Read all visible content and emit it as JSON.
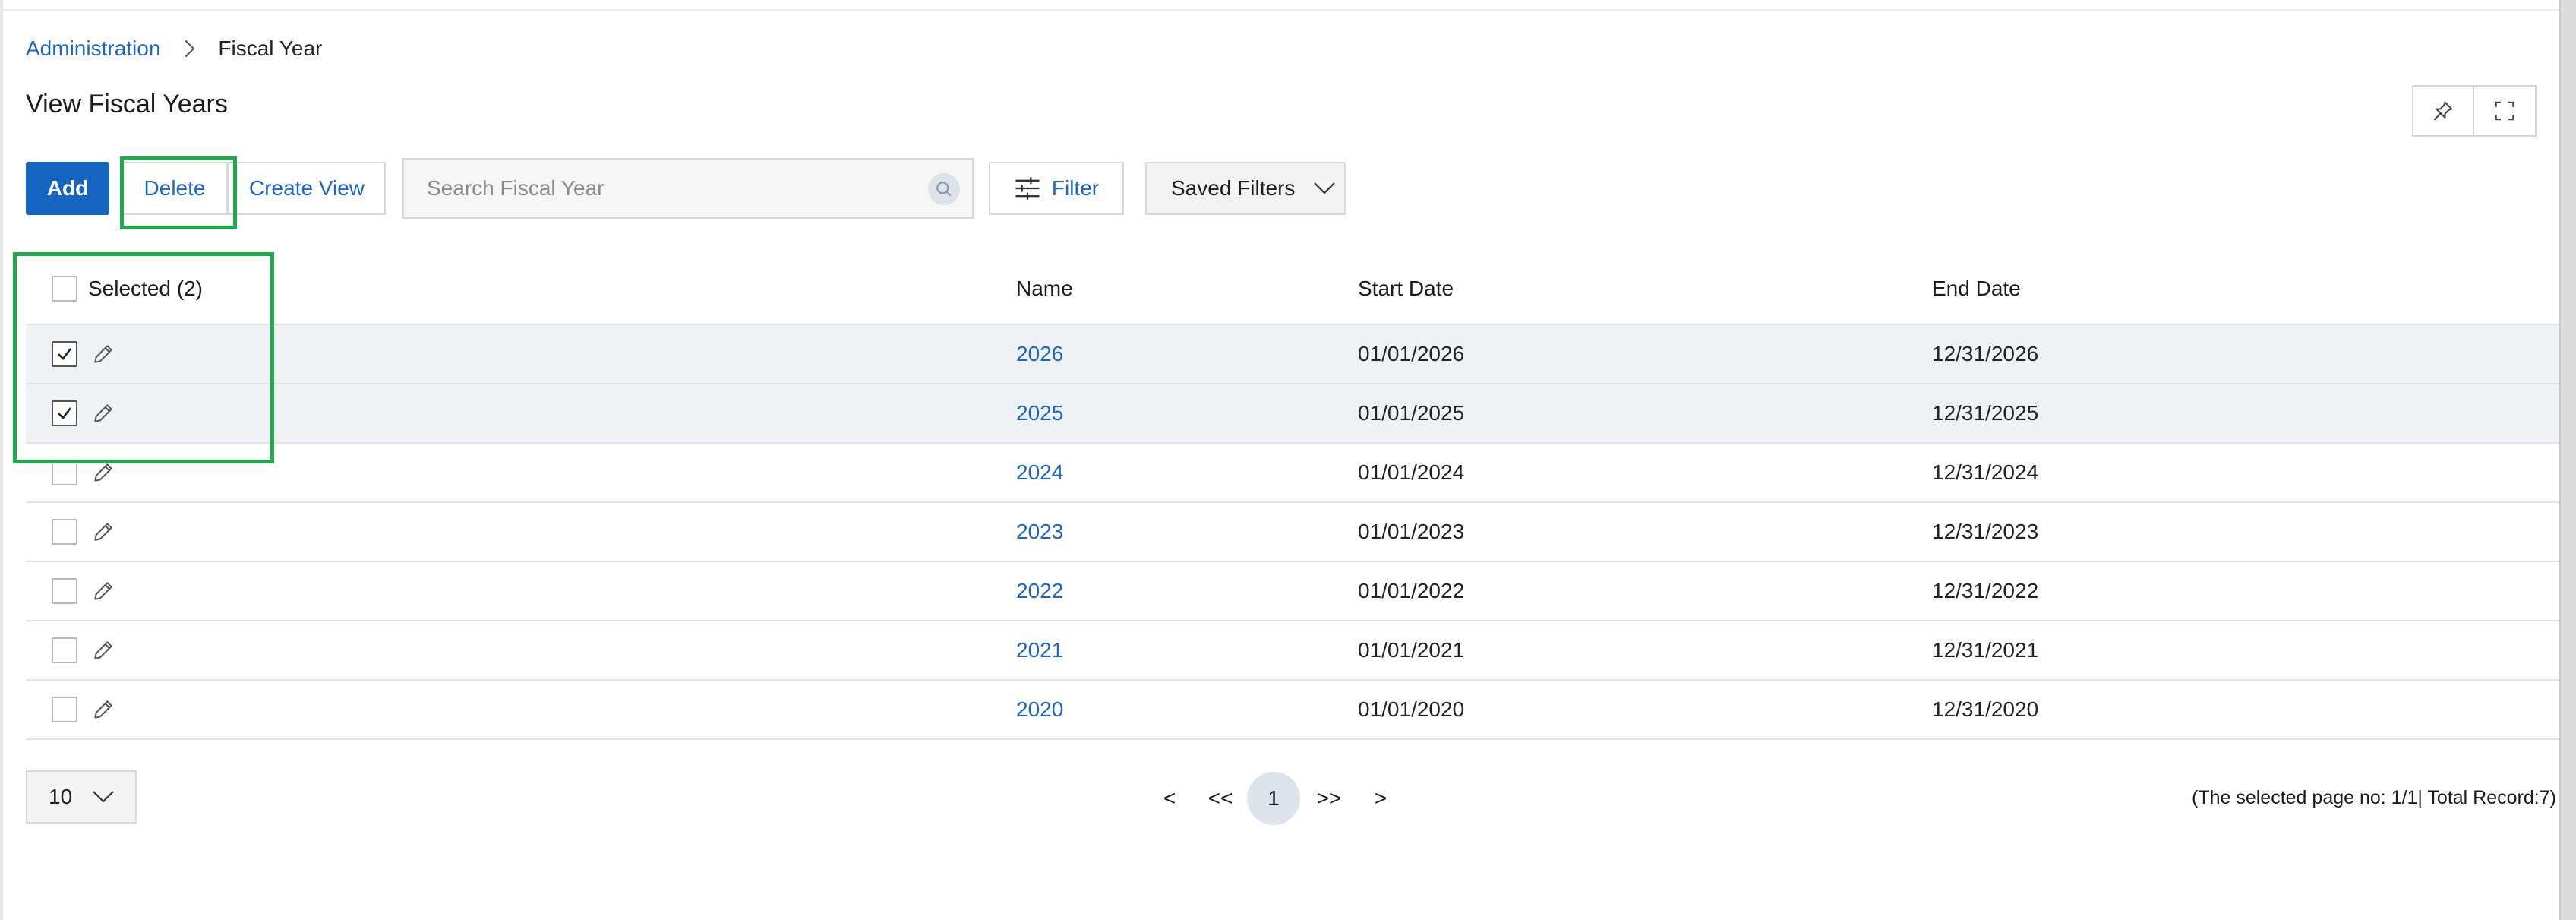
{
  "breadcrumb": {
    "parent": "Administration",
    "current": "Fiscal Year"
  },
  "page": {
    "title": "View Fiscal Years"
  },
  "toolbar": {
    "add": "Add",
    "delete": "Delete",
    "create_view": "Create View",
    "search_placeholder": "Search Fiscal Year",
    "search_value": "",
    "filter": "Filter",
    "saved_filters": "Saved Filters"
  },
  "table": {
    "headers": {
      "selected": "Selected (2)",
      "name": "Name",
      "start_date": "Start Date",
      "end_date": "End Date"
    },
    "rows": [
      {
        "name": "2026",
        "start": "01/01/2026",
        "end": "12/31/2026",
        "checked": true
      },
      {
        "name": "2025",
        "start": "01/01/2025",
        "end": "12/31/2025",
        "checked": true
      },
      {
        "name": "2024",
        "start": "01/01/2024",
        "end": "12/31/2024",
        "checked": false
      },
      {
        "name": "2023",
        "start": "01/01/2023",
        "end": "12/31/2023",
        "checked": false
      },
      {
        "name": "2022",
        "start": "01/01/2022",
        "end": "12/31/2022",
        "checked": false
      },
      {
        "name": "2021",
        "start": "01/01/2021",
        "end": "12/31/2021",
        "checked": false
      },
      {
        "name": "2020",
        "start": "01/01/2020",
        "end": "12/31/2020",
        "checked": false
      }
    ]
  },
  "pagination": {
    "page_size": "10",
    "prev": "<",
    "first": "<<",
    "current": "1",
    "last": ">>",
    "next": ">",
    "info": "(The selected page no: 1/1| Total Record:7)"
  },
  "colors": {
    "accent": "#1565c0",
    "link": "#1f66c1",
    "highlight": "#21a84a",
    "selected_row": "#eef2f7"
  },
  "icons": [
    "chevron-right-icon",
    "pin-icon",
    "fullscreen-icon",
    "search-icon",
    "sliders-icon",
    "chevron-down-icon",
    "checkmark-icon",
    "pencil-icon"
  ]
}
